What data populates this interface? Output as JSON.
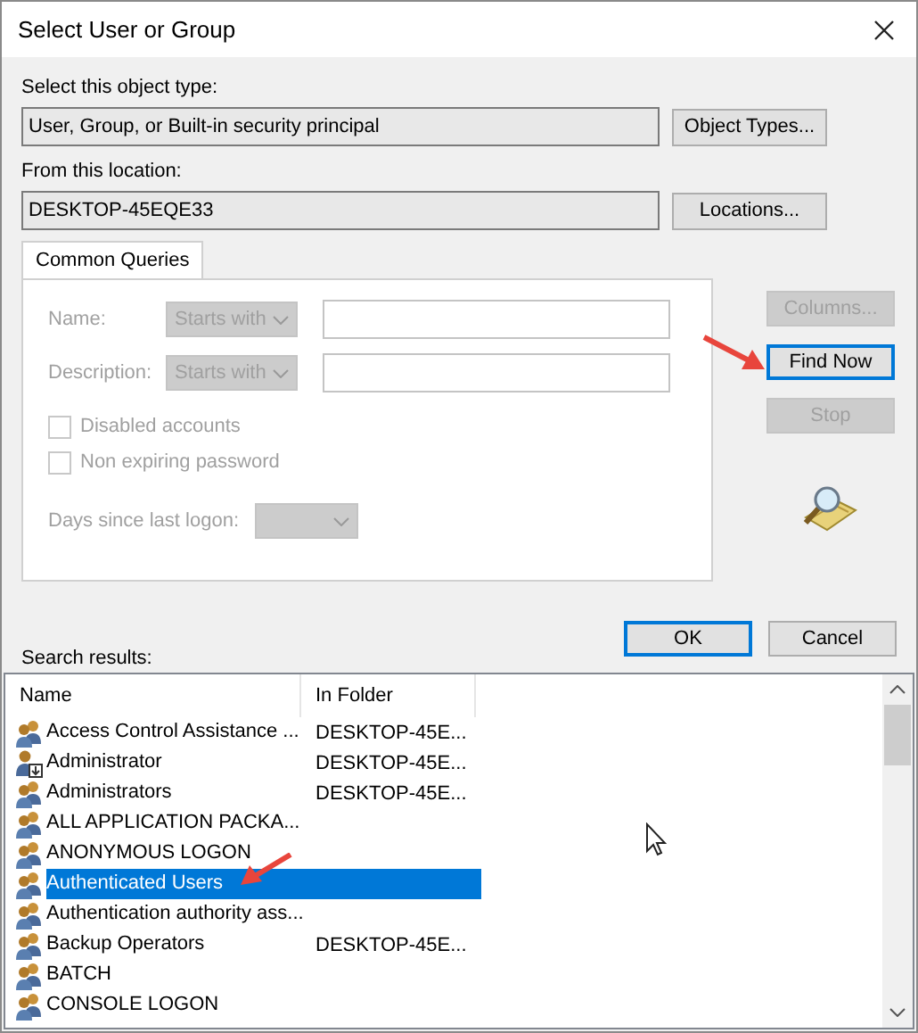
{
  "window": {
    "title": "Select User or Group"
  },
  "object_type": {
    "label": "Select this object type:",
    "value": "User, Group, or Built-in security principal",
    "button": "Object Types..."
  },
  "location": {
    "label": "From this location:",
    "value": "DESKTOP-45EQE33",
    "button": "Locations..."
  },
  "tabs": [
    {
      "label": "Common Queries",
      "selected": true
    }
  ],
  "query": {
    "disabled": true,
    "fields": [
      {
        "label": "Name:",
        "operator": "Starts with"
      },
      {
        "label": "Description:",
        "operator": "Starts with"
      }
    ],
    "checkboxes": [
      {
        "label": "Disabled accounts",
        "checked": false
      },
      {
        "label": "Non expiring password",
        "checked": false
      }
    ],
    "days_label": "Days since last logon:"
  },
  "side_buttons": [
    {
      "label": "Columns...",
      "disabled": true,
      "highlighted": false
    },
    {
      "label": "Find Now",
      "disabled": false,
      "highlighted": true
    },
    {
      "label": "Stop",
      "disabled": true,
      "highlighted": false
    }
  ],
  "dialog_buttons": [
    {
      "label": "OK",
      "highlighted": true
    },
    {
      "label": "Cancel",
      "highlighted": false
    }
  ],
  "search_results": {
    "label": "Search results:",
    "columns": [
      "Name",
      "In Folder"
    ],
    "rows": [
      {
        "kind": "group",
        "name": "Access Control Assistance ...",
        "folder": "DESKTOP-45E...",
        "selected": false
      },
      {
        "kind": "user",
        "name": "Administrator",
        "folder": "DESKTOP-45E...",
        "selected": false
      },
      {
        "kind": "group",
        "name": "Administrators",
        "folder": "DESKTOP-45E...",
        "selected": false
      },
      {
        "kind": "group",
        "name": "ALL APPLICATION PACKA...",
        "selected": false
      },
      {
        "kind": "group",
        "name": "ANONYMOUS LOGON",
        "selected": false
      },
      {
        "kind": "group",
        "name": "Authenticated Users",
        "selected": true
      },
      {
        "kind": "group",
        "name": "Authentication authority ass...",
        "selected": false
      },
      {
        "kind": "group",
        "name": "Backup Operators",
        "folder": "DESKTOP-45E...",
        "selected": false
      },
      {
        "kind": "group",
        "name": "BATCH",
        "selected": false
      },
      {
        "kind": "group",
        "name": "CONSOLE LOGON",
        "selected": false
      }
    ]
  }
}
